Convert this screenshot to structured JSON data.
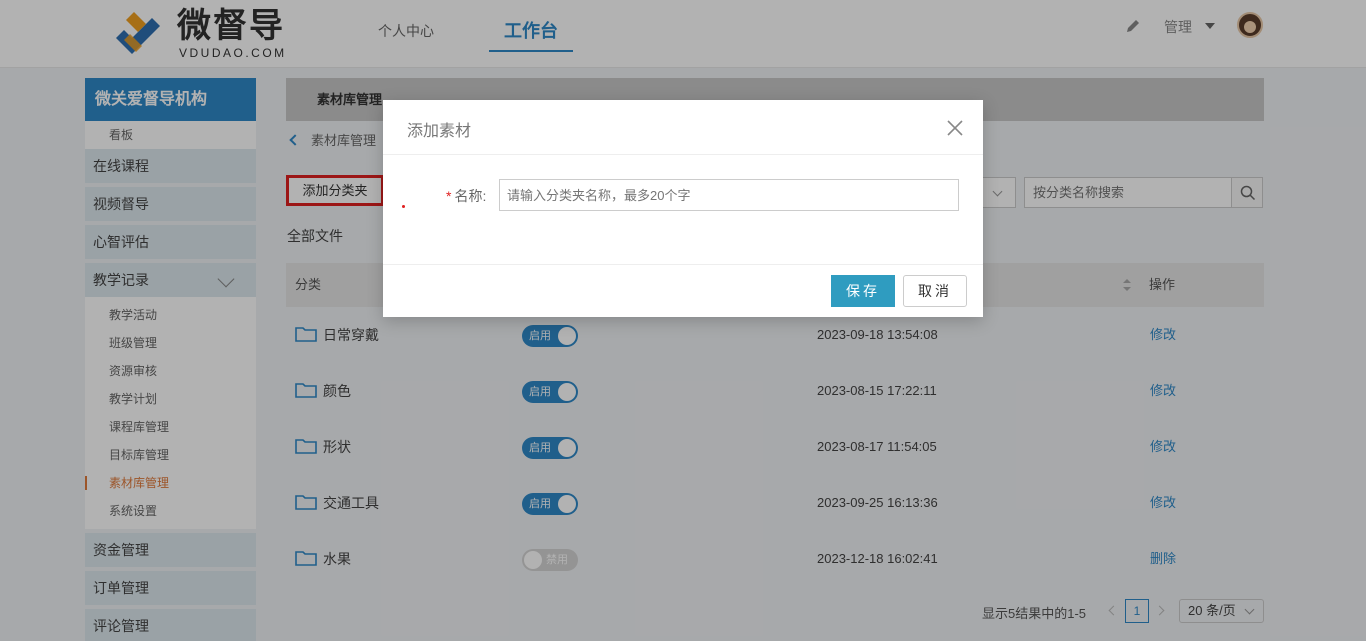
{
  "header": {
    "logo_cn": "微督导",
    "logo_en": "VDUDAO.COM",
    "nav": [
      {
        "label": "个人中心"
      },
      {
        "label": "工作台"
      }
    ],
    "admin_label": "管理"
  },
  "sidebar": {
    "org_title": "微关爱督导机构",
    "top_sub": "看板",
    "groups_before": [
      {
        "label": "在线课程"
      },
      {
        "label": "视频督导"
      },
      {
        "label": "心智评估"
      },
      {
        "label": "教学记录"
      }
    ],
    "teaching_subitems": [
      {
        "label": "教学活动"
      },
      {
        "label": "班级管理"
      },
      {
        "label": "资源审核"
      },
      {
        "label": "教学计划"
      },
      {
        "label": "课程库管理"
      },
      {
        "label": "目标库管理"
      },
      {
        "label": "素材库管理"
      },
      {
        "label": "系统设置"
      }
    ],
    "groups_after": [
      {
        "label": "资金管理"
      },
      {
        "label": "订单管理"
      },
      {
        "label": "评论管理"
      }
    ]
  },
  "main": {
    "page_title": "素材库管理",
    "breadcrumb": "素材库管理",
    "add_folder_label": "添加分类夹",
    "all_files_label": "全部文件",
    "search_placeholder": "按分类名称搜索",
    "table": {
      "col_category": "分类",
      "col_actions": "操作",
      "rows": [
        {
          "name": "日常穿戴",
          "status": "启用",
          "date": "2023-09-18 13:54:08",
          "action": "修改"
        },
        {
          "name": "颜色",
          "status": "启用",
          "date": "2023-08-15 17:22:11",
          "action": "修改"
        },
        {
          "name": "形状",
          "status": "启用",
          "date": "2023-08-17 11:54:05",
          "action": "修改"
        },
        {
          "name": "交通工具",
          "status": "启用",
          "date": "2023-09-25 16:13:36",
          "action": "修改"
        },
        {
          "name": "水果",
          "status": "禁用",
          "date": "2023-12-18 16:02:41",
          "action": "删除"
        }
      ]
    },
    "pager": {
      "info": "显示5结果中的1-5",
      "page": "1",
      "page_size": "20 条/页"
    }
  },
  "modal": {
    "title": "添加素材",
    "field_label": "名称:",
    "required_mark": "*",
    "name_placeholder": "请输入分类夹名称，最多20个字",
    "save_label": "保存",
    "cancel_label": "取消"
  },
  "colors": {
    "primary": "#2f89c8",
    "save_button": "#2f9cc0",
    "highlight_border": "#e02020",
    "active_menu": "#e07a3c"
  }
}
